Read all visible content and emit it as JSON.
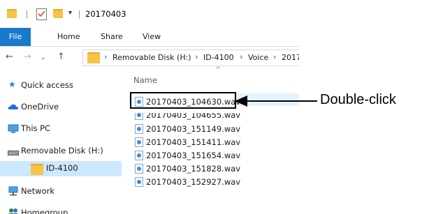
{
  "window": {
    "title": "20170403"
  },
  "ribbon": {
    "tabs": [
      {
        "label": "File"
      },
      {
        "label": "Home"
      },
      {
        "label": "Share"
      },
      {
        "label": "View"
      }
    ]
  },
  "address_bar": {
    "crumbs": [
      "Removable Disk (H:)",
      "ID-4100",
      "Voice",
      "2017"
    ]
  },
  "nav_pane": {
    "items": [
      {
        "label": "Quick access"
      },
      {
        "label": "OneDrive"
      },
      {
        "label": "This PC"
      },
      {
        "label": "Removable Disk (H:)"
      },
      {
        "label": "ID-4100"
      },
      {
        "label": "Network"
      },
      {
        "label": "Homegroup"
      }
    ]
  },
  "file_list": {
    "column_header": "Name",
    "files": [
      {
        "name": "20170403_104630.wav"
      },
      {
        "name": "20170403_104655.wav"
      },
      {
        "name": "20170403_151149.wav"
      },
      {
        "name": "20170403_151411.wav"
      },
      {
        "name": "20170403_151654.wav"
      },
      {
        "name": "20170403_151828.wav"
      },
      {
        "name": "20170403_152927.wav"
      }
    ]
  },
  "annotation": {
    "text": "Double-click"
  }
}
